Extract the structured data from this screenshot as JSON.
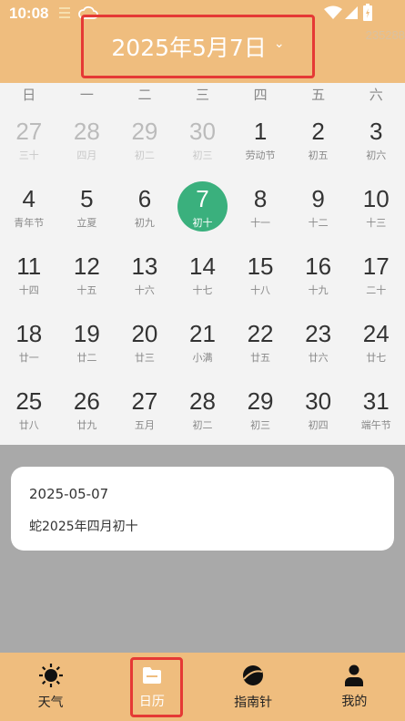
{
  "status": {
    "time": "10:08",
    "counter": "235288"
  },
  "header": {
    "date_title": "2025年5月7日"
  },
  "weekdays": [
    "日",
    "一",
    "二",
    "三",
    "四",
    "五",
    "六"
  ],
  "days": [
    {
      "num": "27",
      "lunar": "三十",
      "state": "prev"
    },
    {
      "num": "28",
      "lunar": "四月",
      "state": "prev"
    },
    {
      "num": "29",
      "lunar": "初二",
      "state": "prev"
    },
    {
      "num": "30",
      "lunar": "初三",
      "state": "prev"
    },
    {
      "num": "1",
      "lunar": "劳动节",
      "state": "normal"
    },
    {
      "num": "2",
      "lunar": "初五",
      "state": "normal"
    },
    {
      "num": "3",
      "lunar": "初六",
      "state": "normal"
    },
    {
      "num": "4",
      "lunar": "青年节",
      "state": "normal"
    },
    {
      "num": "5",
      "lunar": "立夏",
      "state": "normal"
    },
    {
      "num": "6",
      "lunar": "初九",
      "state": "normal"
    },
    {
      "num": "7",
      "lunar": "初十",
      "state": "selected"
    },
    {
      "num": "8",
      "lunar": "十一",
      "state": "normal"
    },
    {
      "num": "9",
      "lunar": "十二",
      "state": "normal"
    },
    {
      "num": "10",
      "lunar": "十三",
      "state": "normal"
    },
    {
      "num": "11",
      "lunar": "十四",
      "state": "normal"
    },
    {
      "num": "12",
      "lunar": "十五",
      "state": "normal"
    },
    {
      "num": "13",
      "lunar": "十六",
      "state": "normal"
    },
    {
      "num": "14",
      "lunar": "十七",
      "state": "normal"
    },
    {
      "num": "15",
      "lunar": "十八",
      "state": "normal"
    },
    {
      "num": "16",
      "lunar": "十九",
      "state": "normal"
    },
    {
      "num": "17",
      "lunar": "二十",
      "state": "normal"
    },
    {
      "num": "18",
      "lunar": "廿一",
      "state": "normal"
    },
    {
      "num": "19",
      "lunar": "廿二",
      "state": "normal"
    },
    {
      "num": "20",
      "lunar": "廿三",
      "state": "normal"
    },
    {
      "num": "21",
      "lunar": "小满",
      "state": "normal"
    },
    {
      "num": "22",
      "lunar": "廿五",
      "state": "normal"
    },
    {
      "num": "23",
      "lunar": "廿六",
      "state": "normal"
    },
    {
      "num": "24",
      "lunar": "廿七",
      "state": "normal"
    },
    {
      "num": "25",
      "lunar": "廿八",
      "state": "normal"
    },
    {
      "num": "26",
      "lunar": "廿九",
      "state": "normal"
    },
    {
      "num": "27",
      "lunar": "五月",
      "state": "normal"
    },
    {
      "num": "28",
      "lunar": "初二",
      "state": "normal"
    },
    {
      "num": "29",
      "lunar": "初三",
      "state": "normal"
    },
    {
      "num": "30",
      "lunar": "初四",
      "state": "normal"
    },
    {
      "num": "31",
      "lunar": "端午节",
      "state": "normal"
    }
  ],
  "info_card": {
    "date": "2025-05-07",
    "lunar": "蛇2025年四月初十"
  },
  "nav": [
    {
      "label": "天气",
      "icon": "sun-icon"
    },
    {
      "label": "日历",
      "icon": "folder-icon"
    },
    {
      "label": "指南针",
      "icon": "planet-icon"
    },
    {
      "label": "我的",
      "icon": "person-icon"
    }
  ],
  "colors": {
    "header_bg": "#efbd7e",
    "selected_day": "#3ab07d",
    "highlight_border": "#e53935",
    "overlay_bg": "#a9a9a9"
  }
}
